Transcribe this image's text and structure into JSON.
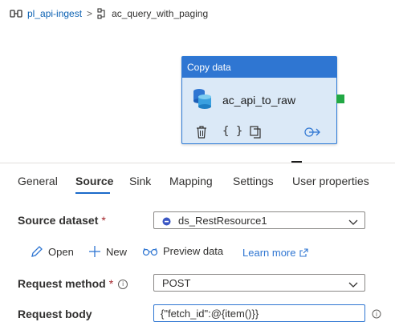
{
  "breadcrumb": {
    "pipeline": "pl_api-ingest",
    "separator": ">",
    "activity": "ac_query_with_paging"
  },
  "activity_card": {
    "header": "Copy data",
    "name": "ac_api_to_raw"
  },
  "tabs": [
    {
      "label": "General"
    },
    {
      "label": "Source"
    },
    {
      "label": "Sink"
    },
    {
      "label": "Mapping"
    },
    {
      "label": "Settings"
    },
    {
      "label": "User properties"
    }
  ],
  "active_tab": "Source",
  "source": {
    "dataset_label": "Source dataset",
    "required_mark": "*",
    "dataset_value": "ds_RestResource1",
    "actions": {
      "open": "Open",
      "new": "New",
      "preview": "Preview data",
      "learn_more": "Learn more"
    },
    "method_label": "Request method",
    "method_value": "POST",
    "body_label": "Request body",
    "body_value": "{\"fetch_id\":@{item()}}"
  },
  "colors": {
    "accent": "#2f76d2",
    "card_bg": "#dbe9f7",
    "success_handle": "#22a845",
    "required": "#a4262c",
    "link": "#0b61b3"
  },
  "icons": [
    "pipeline-icon",
    "activity-icon",
    "database-icon",
    "delete-icon",
    "code-icon",
    "copy-icon",
    "output-arrow-icon",
    "pencil-icon",
    "plus-icon",
    "glasses-icon",
    "external-link-icon",
    "info-icon",
    "chevron-down-icon",
    "dynamic-content-icon"
  ]
}
